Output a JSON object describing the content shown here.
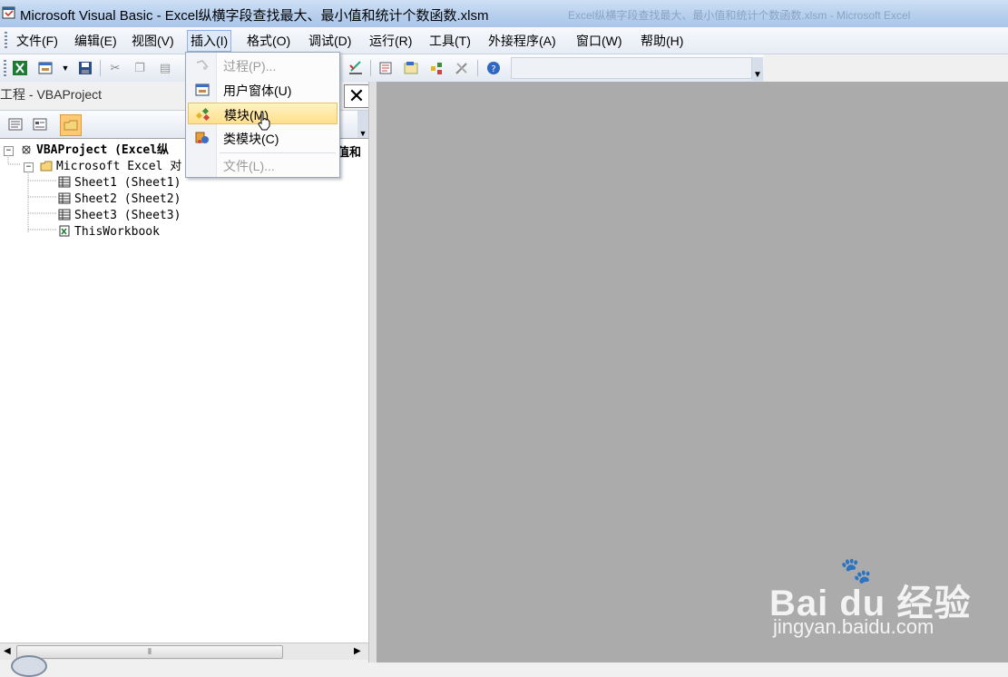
{
  "window": {
    "title": "Microsoft Visual Basic - Excel纵横字段查找最大、最小值和统计个数函数.xlsm",
    "background_title": "Excel纵横字段查找最大、最小值和统计个数函数.xlsm - Microsoft Excel"
  },
  "menubar": {
    "items": [
      {
        "label": "文件(F)"
      },
      {
        "label": "编辑(E)"
      },
      {
        "label": "视图(V)"
      },
      {
        "label": "插入(I)"
      },
      {
        "label": "格式(O)"
      },
      {
        "label": "调试(D)"
      },
      {
        "label": "运行(R)"
      },
      {
        "label": "工具(T)"
      },
      {
        "label": "外接程序(A)"
      },
      {
        "label": "窗口(W)"
      },
      {
        "label": "帮助(H)"
      }
    ],
    "active": "插入(I)"
  },
  "insert_menu": {
    "items": [
      {
        "label": "过程(P)...",
        "enabled": false,
        "icon": "procedure-icon"
      },
      {
        "label": "用户窗体(U)",
        "enabled": true,
        "icon": "userform-icon"
      },
      {
        "label": "模块(M)",
        "enabled": true,
        "icon": "module-icon",
        "highlighted": true
      },
      {
        "label": "类模块(C)",
        "enabled": true,
        "icon": "class-module-icon"
      },
      {
        "label": "文件(L)...",
        "enabled": false,
        "icon": ""
      }
    ]
  },
  "project_panel": {
    "title": "工程 - VBAProject",
    "close_glyph": "✕",
    "truncated_suffix": "值和",
    "tree": [
      {
        "label": "VBAProject (Excel纵",
        "level": 0,
        "expander": "−",
        "bold": true,
        "icon": "vbaproject-icon"
      },
      {
        "label": "Microsoft Excel 对",
        "level": 1,
        "expander": "−",
        "icon": "folder-icon"
      },
      {
        "label": "Sheet1 (Sheet1)",
        "level": 2,
        "icon": "sheet-icon"
      },
      {
        "label": "Sheet2 (Sheet2)",
        "level": 2,
        "icon": "sheet-icon"
      },
      {
        "label": "Sheet3 (Sheet3)",
        "level": 2,
        "icon": "sheet-icon"
      },
      {
        "label": "ThisWorkbook",
        "level": 2,
        "icon": "workbook-icon"
      }
    ]
  },
  "watermark": {
    "main": "Bai du 经验",
    "sub": "jingyan.baidu.com"
  },
  "colors": {
    "menu_highlight": "#ffe08c",
    "mdi_background": "#ababab"
  }
}
